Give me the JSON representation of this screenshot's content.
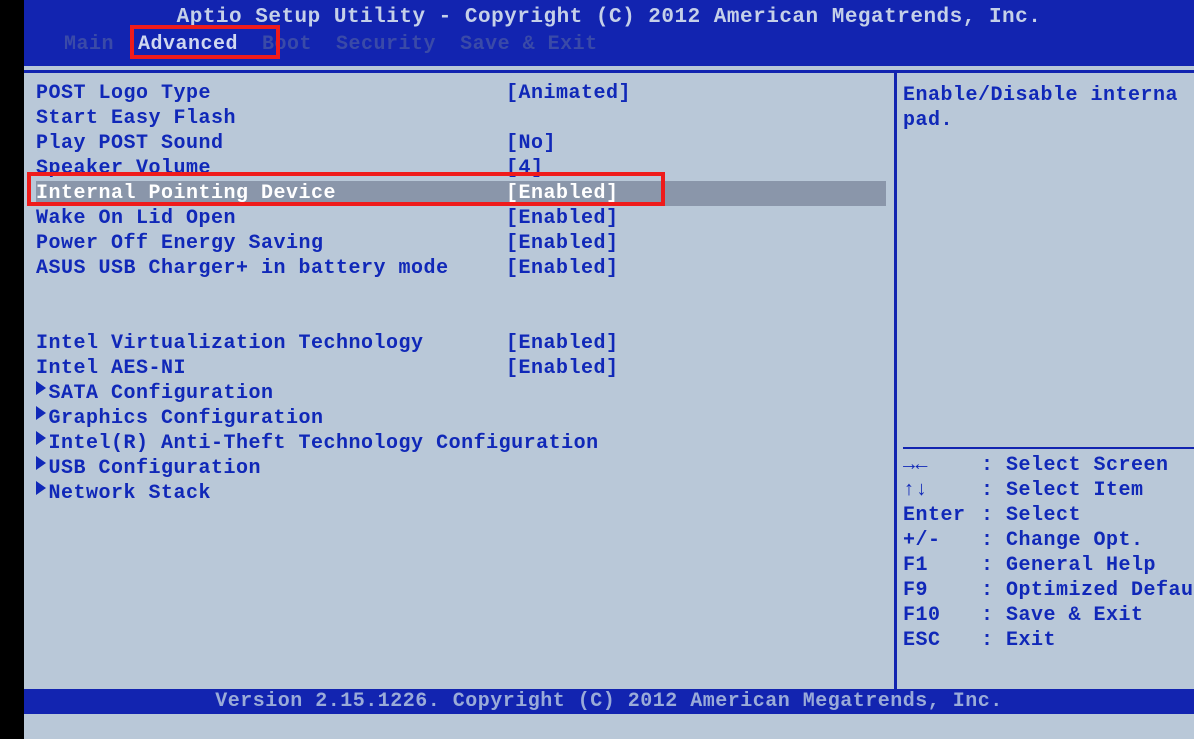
{
  "header": {
    "title": "Aptio Setup Utility - Copyright (C) 2012 American Megatrends, Inc.",
    "menu": [
      "Main",
      "Advanced",
      "Boot",
      "Security",
      "Save & Exit"
    ],
    "active_index": 1
  },
  "settings": {
    "items": [
      {
        "label": "POST Logo Type",
        "value": "[Animated]",
        "type": "option"
      },
      {
        "label": "Start Easy Flash",
        "value": "",
        "type": "action"
      },
      {
        "label": "Play POST Sound",
        "value": "[No]",
        "type": "option"
      },
      {
        "label": "Speaker Volume",
        "value": "[4]",
        "type": "option"
      },
      {
        "label": "Internal Pointing Device",
        "value": "[Enabled]",
        "type": "option",
        "selected": true
      },
      {
        "label": "Wake On Lid Open",
        "value": "[Enabled]",
        "type": "option"
      },
      {
        "label": "Power Off Energy Saving",
        "value": "[Enabled]",
        "type": "option"
      },
      {
        "label": "ASUS USB Charger+ in battery mode",
        "value": "[Enabled]",
        "type": "option"
      },
      {
        "type": "spacer"
      },
      {
        "type": "spacer"
      },
      {
        "label": "Intel Virtualization Technology",
        "value": "[Enabled]",
        "type": "option"
      },
      {
        "label": "Intel AES-NI",
        "value": "[Enabled]",
        "type": "option"
      },
      {
        "label": "SATA Configuration",
        "value": "",
        "type": "submenu"
      },
      {
        "label": "Graphics Configuration",
        "value": "",
        "type": "submenu"
      },
      {
        "label": "Intel(R) Anti-Theft Technology Configuration",
        "value": "",
        "type": "submenu"
      },
      {
        "label": "USB Configuration",
        "value": "",
        "type": "submenu"
      },
      {
        "label": "Network Stack",
        "value": "",
        "type": "submenu"
      }
    ]
  },
  "help": {
    "description_line1": "Enable/Disable interna",
    "description_line2": "pad.",
    "keys": [
      {
        "key": "→←",
        "desc": ": Select Screen"
      },
      {
        "key": "↑↓",
        "desc": ": Select Item"
      },
      {
        "key": "Enter",
        "desc": ": Select"
      },
      {
        "key": "+/-",
        "desc": ": Change Opt."
      },
      {
        "key": "F1",
        "desc": ": General Help"
      },
      {
        "key": "F9",
        "desc": ": Optimized Defaul"
      },
      {
        "key": "F10",
        "desc": ": Save & Exit"
      },
      {
        "key": "ESC",
        "desc": ": Exit"
      }
    ]
  },
  "footer": {
    "text": "Version 2.15.1226. Copyright (C) 2012 American Megatrends, Inc."
  }
}
